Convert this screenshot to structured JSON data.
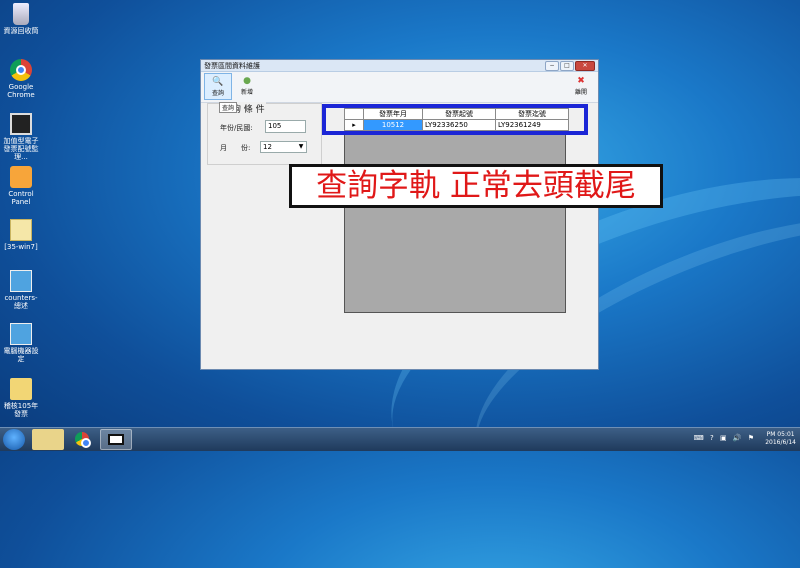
{
  "desktop": {
    "icons": [
      {
        "label": "資源回收筒",
        "icon": "recycle-bin-icon"
      },
      {
        "label": "Google Chrome",
        "icon": "chrome-icon"
      },
      {
        "label": "加值型電子發票配號監理...",
        "icon": "monitor-app-icon"
      },
      {
        "label": "Control Panel",
        "icon": "control-panel-icon"
      },
      {
        "label": "[35-win7]",
        "icon": "file-icon"
      },
      {
        "label": "counters-總述",
        "icon": "app-icon"
      },
      {
        "label": "電腦機器設定",
        "icon": "app-icon"
      },
      {
        "label": "稽核105年發票",
        "icon": "folder-icon"
      }
    ]
  },
  "window": {
    "title": "發票區間資料維護",
    "controls": {
      "minimize": "−",
      "maximize": "□",
      "close": "✕"
    },
    "toolbar": {
      "query_label": "查詢",
      "add_label": "新增",
      "exit_label": "離開",
      "tooltip": "查詢"
    },
    "criteria": {
      "group_title": "查 詢 條 件",
      "year_label": "年份/民國:",
      "year_value": "105",
      "month_label": "月　　份:",
      "month_value": "12"
    },
    "grid": {
      "columns": [
        "發票年月",
        "發票起號",
        "發票迄號"
      ],
      "rows": [
        {
          "selector": "▸",
          "cells": [
            "10512",
            "LY92336250",
            "LY92361249"
          ]
        }
      ]
    }
  },
  "annotation": {
    "text": "查詢字軌 正常去頭截尾",
    "text_color": "#e01818",
    "frame_color": "#1b26d6"
  },
  "taskbar": {
    "tray_icons": [
      "keyboard-icon",
      "help-icon",
      "network-icon",
      "volume-icon",
      "flag-icon"
    ],
    "time": "PM 05:01",
    "date": "2016/6/14"
  }
}
